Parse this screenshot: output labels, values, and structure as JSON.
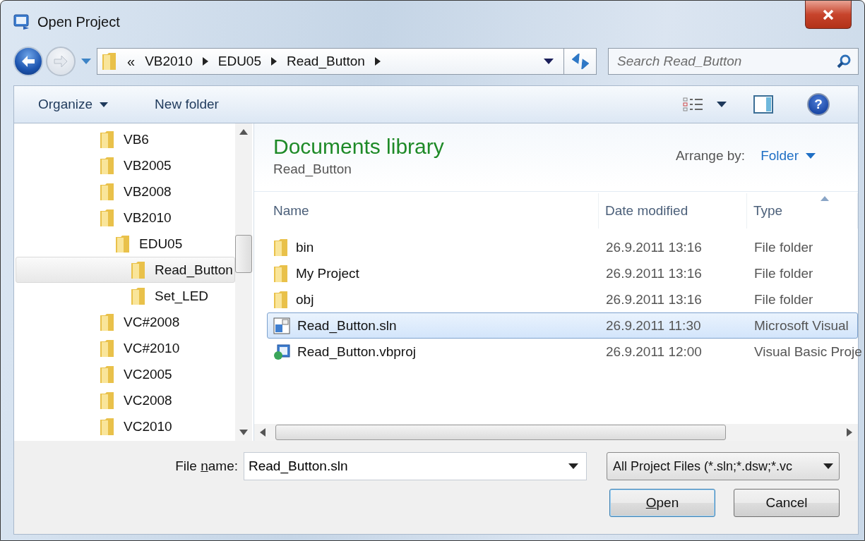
{
  "window": {
    "title": "Open Project"
  },
  "address_bar": {
    "overflow": "«",
    "segments": [
      "VB2010",
      "EDU05",
      "Read_Button"
    ]
  },
  "search": {
    "placeholder": "Search Read_Button"
  },
  "toolbar": {
    "buttons": [
      {
        "label": "Organize",
        "menu": true
      },
      {
        "label": "New folder",
        "menu": false
      }
    ],
    "help_glyph": "?"
  },
  "tree": [
    {
      "label": "VB6",
      "selected": false
    },
    {
      "label": "VB2005",
      "selected": false
    },
    {
      "label": "VB2008",
      "selected": false
    },
    {
      "label": "VB2010",
      "selected": false,
      "children": [
        {
          "label": "EDU05",
          "selected": false,
          "children": [
            {
              "label": "Read_Button",
              "selected": true
            },
            {
              "label": "Set_LED",
              "selected": false
            }
          ]
        }
      ]
    },
    {
      "label": "VC#2008",
      "selected": false
    },
    {
      "label": "VC#2010",
      "selected": false
    },
    {
      "label": "VC2005",
      "selected": false
    },
    {
      "label": "VC2008",
      "selected": false
    },
    {
      "label": "VC2010",
      "selected": false
    }
  ],
  "library": {
    "title": "Documents library",
    "subtitle": "Read_Button",
    "arrange_label": "Arrange by:",
    "arrange_value": "Folder"
  },
  "columns": [
    {
      "label": "Name",
      "sorted": false
    },
    {
      "label": "Date modified",
      "sorted": false
    },
    {
      "label": "Type",
      "sorted": true
    }
  ],
  "files": [
    {
      "name": "bin",
      "date": "26.9.2011 13:16",
      "type": "File folder",
      "kind": "folder",
      "selected": false
    },
    {
      "name": "My Project",
      "date": "26.9.2011 13:16",
      "type": "File folder",
      "kind": "folder",
      "selected": false
    },
    {
      "name": "obj",
      "date": "26.9.2011 13:16",
      "type": "File folder",
      "kind": "folder",
      "selected": false
    },
    {
      "name": "Read_Button.sln",
      "date": "26.9.2011 11:30",
      "type": "Microsoft Visual",
      "kind": "solution",
      "selected": true
    },
    {
      "name": "Read_Button.vbproj",
      "date": "26.9.2011 12:00",
      "type": "Visual Basic Proje",
      "kind": "project",
      "selected": false
    }
  ],
  "file_name": {
    "label": [
      {
        "text": "File ",
        "underline": false
      },
      {
        "text": "n",
        "underline": true
      },
      {
        "text": "ame:",
        "underline": false
      }
    ],
    "value": "Read_Button.sln"
  },
  "filter": {
    "value": "All Project Files (*.sln;*.dsw;*.vc"
  },
  "buttons": [
    {
      "kind": "default",
      "label": [
        {
          "text": "O",
          "underline": true
        },
        {
          "text": "pen",
          "underline": false
        }
      ]
    },
    {
      "kind": "normal",
      "label": [
        {
          "text": "Cancel",
          "underline": false
        }
      ]
    }
  ]
}
